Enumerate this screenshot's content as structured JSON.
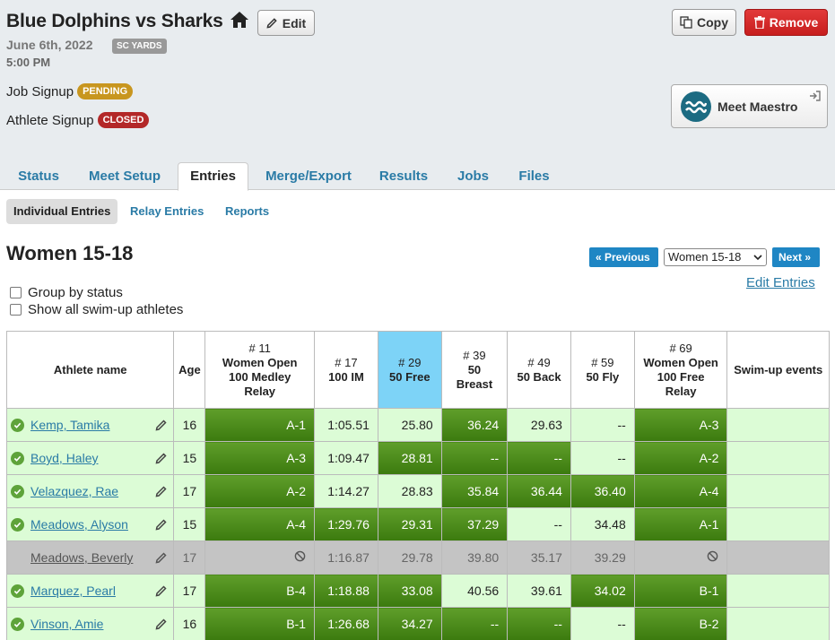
{
  "meet": {
    "title": "Blue Dolphins vs Sharks",
    "date": "June 6th, 2022",
    "course": "SC YARDS",
    "time": "5:00 PM",
    "edit_label": "Edit",
    "copy_label": "Copy",
    "remove_label": "Remove",
    "job_signup_label": "Job Signup",
    "job_signup_status": "PENDING",
    "athlete_signup_label": "Athlete Signup",
    "athlete_signup_status": "CLOSED",
    "maestro_label": "Meet Maestro"
  },
  "colors": {
    "pending": "#c8961f",
    "closed": "#b32828",
    "remove": "#c71e1e",
    "link": "#2a7ba6",
    "entered_dark": "#4a8a1c",
    "entered_light": "#dcfcd6",
    "highlight_col": "#7dd3f7"
  },
  "tabs": [
    "Status",
    "Meet Setup",
    "Entries",
    "Merge/Export",
    "Results",
    "Jobs",
    "Files"
  ],
  "subtabs": [
    "Individual Entries",
    "Relay Entries",
    "Reports"
  ],
  "group": {
    "title": "Women 15-18",
    "prev_label": "« Previous",
    "next_label": "Next »",
    "selected": "Women 15-18",
    "edit_entries_label": "Edit Entries"
  },
  "options": {
    "group_by_status": "Group by status",
    "show_swimup": "Show all swim-up athletes"
  },
  "table": {
    "col_name": "Athlete name",
    "col_age": "Age",
    "col_swimup": "Swim-up events",
    "events": [
      {
        "num": "# 11",
        "name": "Women Open 100 Medley Relay"
      },
      {
        "num": "# 17",
        "name": "100 IM"
      },
      {
        "num": "# 29",
        "name": "50 Free"
      },
      {
        "num": "# 39",
        "name": "50 Breast"
      },
      {
        "num": "# 49",
        "name": "50 Back"
      },
      {
        "num": "# 59",
        "name": "50 Fly"
      },
      {
        "num": "# 69",
        "name": "Women Open 100 Free Relay"
      }
    ],
    "rows": [
      {
        "name": "Kemp, Tamika",
        "age": "16",
        "cells": [
          "A-1",
          "1:05.51",
          "25.80",
          "36.24",
          "29.63",
          "--",
          "A-3"
        ]
      },
      {
        "name": "Boyd, Haley",
        "age": "15",
        "cells": [
          "A-3",
          "1:09.47",
          "28.81",
          "--",
          "--",
          "--",
          "A-2"
        ]
      },
      {
        "name": "Velazquez, Rae",
        "age": "17",
        "cells": [
          "A-2",
          "1:14.27",
          "28.83",
          "35.84",
          "36.44",
          "36.40",
          "A-4"
        ]
      },
      {
        "name": "Meadows, Alyson",
        "age": "15",
        "cells": [
          "A-4",
          "1:29.76",
          "29.31",
          "37.29",
          "--",
          "34.48",
          "A-1"
        ]
      },
      {
        "name": "Meadows, Beverly",
        "age": "17",
        "cells": [
          "",
          "1:16.87",
          "29.78",
          "39.80",
          "35.17",
          "39.29",
          ""
        ]
      },
      {
        "name": "Marquez, Pearl",
        "age": "17",
        "cells": [
          "B-4",
          "1:18.88",
          "33.08",
          "40.56",
          "39.61",
          "34.02",
          "B-1"
        ]
      },
      {
        "name": "Vinson, Amie",
        "age": "16",
        "cells": [
          "B-1",
          "1:26.68",
          "34.27",
          "--",
          "--",
          "--",
          "B-2"
        ]
      }
    ]
  }
}
